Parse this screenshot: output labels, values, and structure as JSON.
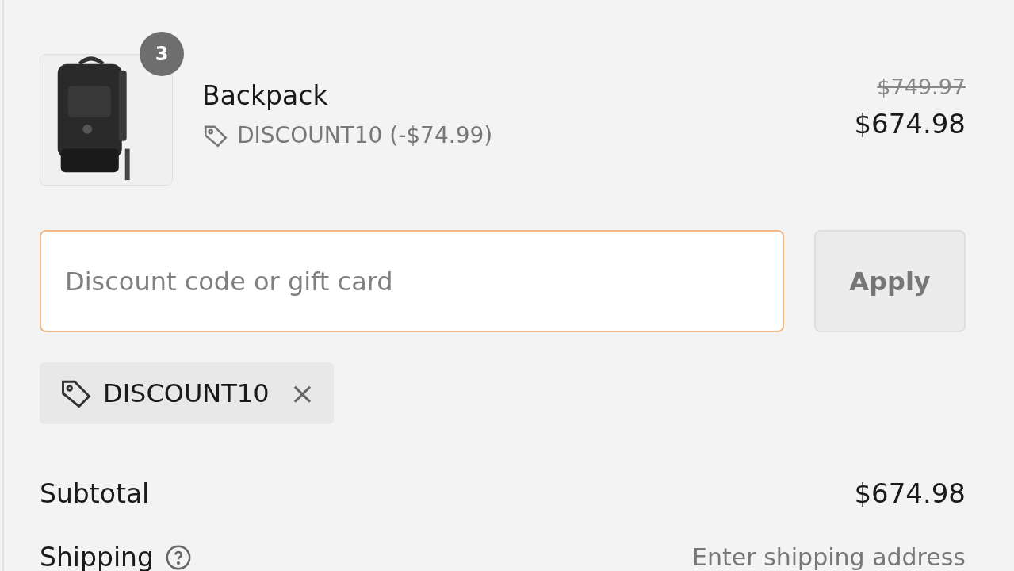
{
  "line_item": {
    "quantity_badge": "3",
    "name": "Backpack",
    "discount": "DISCOUNT10 (-$74.99)",
    "original_price": "$749.97",
    "price": "$674.98"
  },
  "discount_form": {
    "placeholder": "Discount code or gift card",
    "button": "Apply"
  },
  "applied_codes": [
    {
      "code": "DISCOUNT10",
      "remove": "×"
    }
  ],
  "summary": [
    {
      "label": "Subtotal",
      "value": "$674.98",
      "kind": "amount",
      "help": false
    },
    {
      "label": "Shipping",
      "value": "Enter shipping address",
      "kind": "note",
      "help": true
    }
  ]
}
